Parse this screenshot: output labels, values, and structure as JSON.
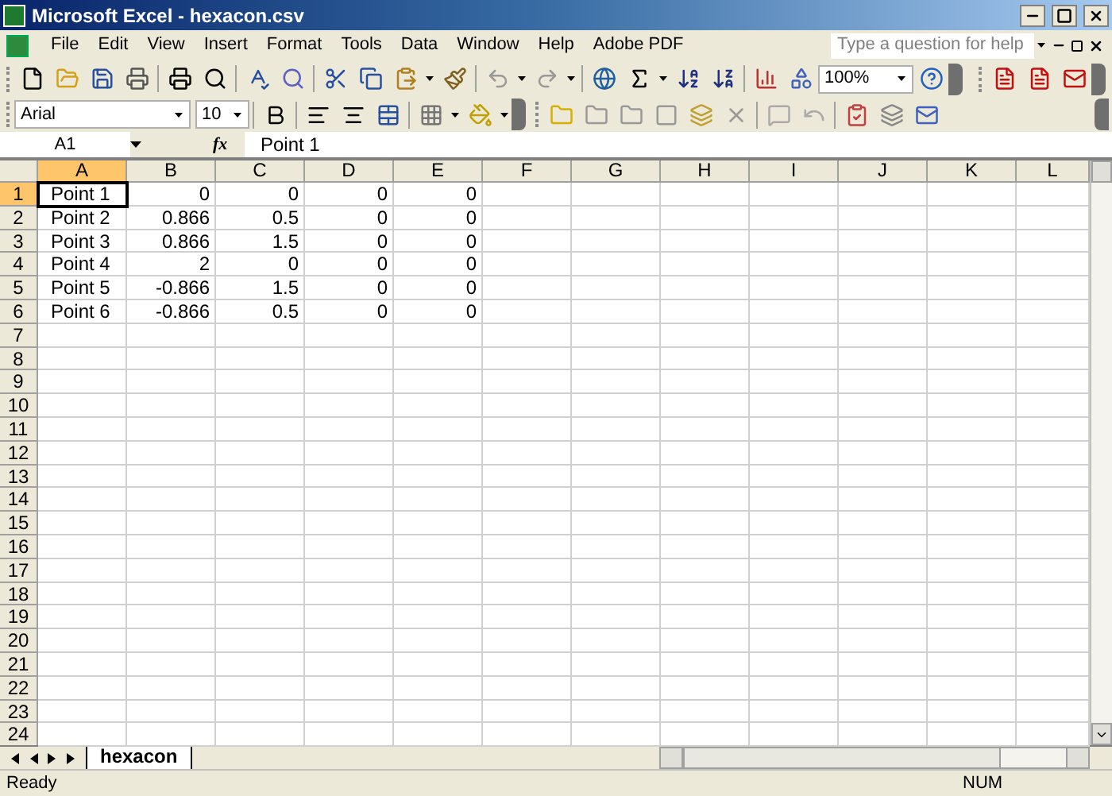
{
  "window": {
    "title": "Microsoft Excel - hexacon.csv"
  },
  "menu": [
    "File",
    "Edit",
    "View",
    "Insert",
    "Format",
    "Tools",
    "Data",
    "Window",
    "Help",
    "Adobe PDF"
  ],
  "help_search": {
    "placeholder": "Type a question for help"
  },
  "formatting": {
    "font": "Arial",
    "size": "10",
    "zoom": "100%"
  },
  "formula_bar": {
    "name_box": "A1",
    "fx": "fx",
    "formula": "Point 1"
  },
  "columns": [
    {
      "label": "A",
      "selected": true
    },
    {
      "label": "B",
      "selected": false
    },
    {
      "label": "C",
      "selected": false
    },
    {
      "label": "D",
      "selected": false
    },
    {
      "label": "E",
      "selected": false
    },
    {
      "label": "F",
      "selected": false
    },
    {
      "label": "G",
      "selected": false
    },
    {
      "label": "H",
      "selected": false
    },
    {
      "label": "I",
      "selected": false
    },
    {
      "label": "J",
      "selected": false
    },
    {
      "label": "K",
      "selected": false
    },
    {
      "label": "L",
      "selected": false
    }
  ],
  "rows": [
    {
      "label": "1",
      "selected": true,
      "cells": [
        "Point 1",
        "0",
        "0",
        "0",
        "0"
      ]
    },
    {
      "label": "2",
      "selected": false,
      "cells": [
        "Point 2",
        "0.866",
        "0.5",
        "0",
        "0"
      ]
    },
    {
      "label": "3",
      "selected": false,
      "cells": [
        "Point 3",
        "0.866",
        "1.5",
        "0",
        "0"
      ]
    },
    {
      "label": "4",
      "selected": false,
      "cells": [
        "Point 4",
        "2",
        "0",
        "0",
        "0"
      ]
    },
    {
      "label": "5",
      "selected": false,
      "cells": [
        "Point 5",
        "-0.866",
        "1.5",
        "0",
        "0"
      ]
    },
    {
      "label": "6",
      "selected": false,
      "cells": [
        "Point 6",
        "-0.866",
        "0.5",
        "0",
        "0"
      ]
    },
    {
      "label": "7",
      "selected": false
    },
    {
      "label": "8",
      "selected": false
    },
    {
      "label": "9",
      "selected": false
    },
    {
      "label": "10",
      "selected": false
    },
    {
      "label": "11",
      "selected": false
    },
    {
      "label": "12",
      "selected": false
    },
    {
      "label": "13",
      "selected": false
    },
    {
      "label": "14",
      "selected": false
    },
    {
      "label": "15",
      "selected": false
    },
    {
      "label": "16",
      "selected": false
    },
    {
      "label": "17",
      "selected": false
    },
    {
      "label": "18",
      "selected": false
    },
    {
      "label": "19",
      "selected": false
    },
    {
      "label": "20",
      "selected": false
    },
    {
      "label": "21",
      "selected": false
    },
    {
      "label": "22",
      "selected": false
    },
    {
      "label": "23",
      "selected": false
    },
    {
      "label": "24",
      "selected": false
    }
  ],
  "sheet_tabs": [
    {
      "label": "hexacon",
      "selected": true
    }
  ],
  "status_bar": {
    "status": "Ready",
    "indicator": "NUM"
  }
}
